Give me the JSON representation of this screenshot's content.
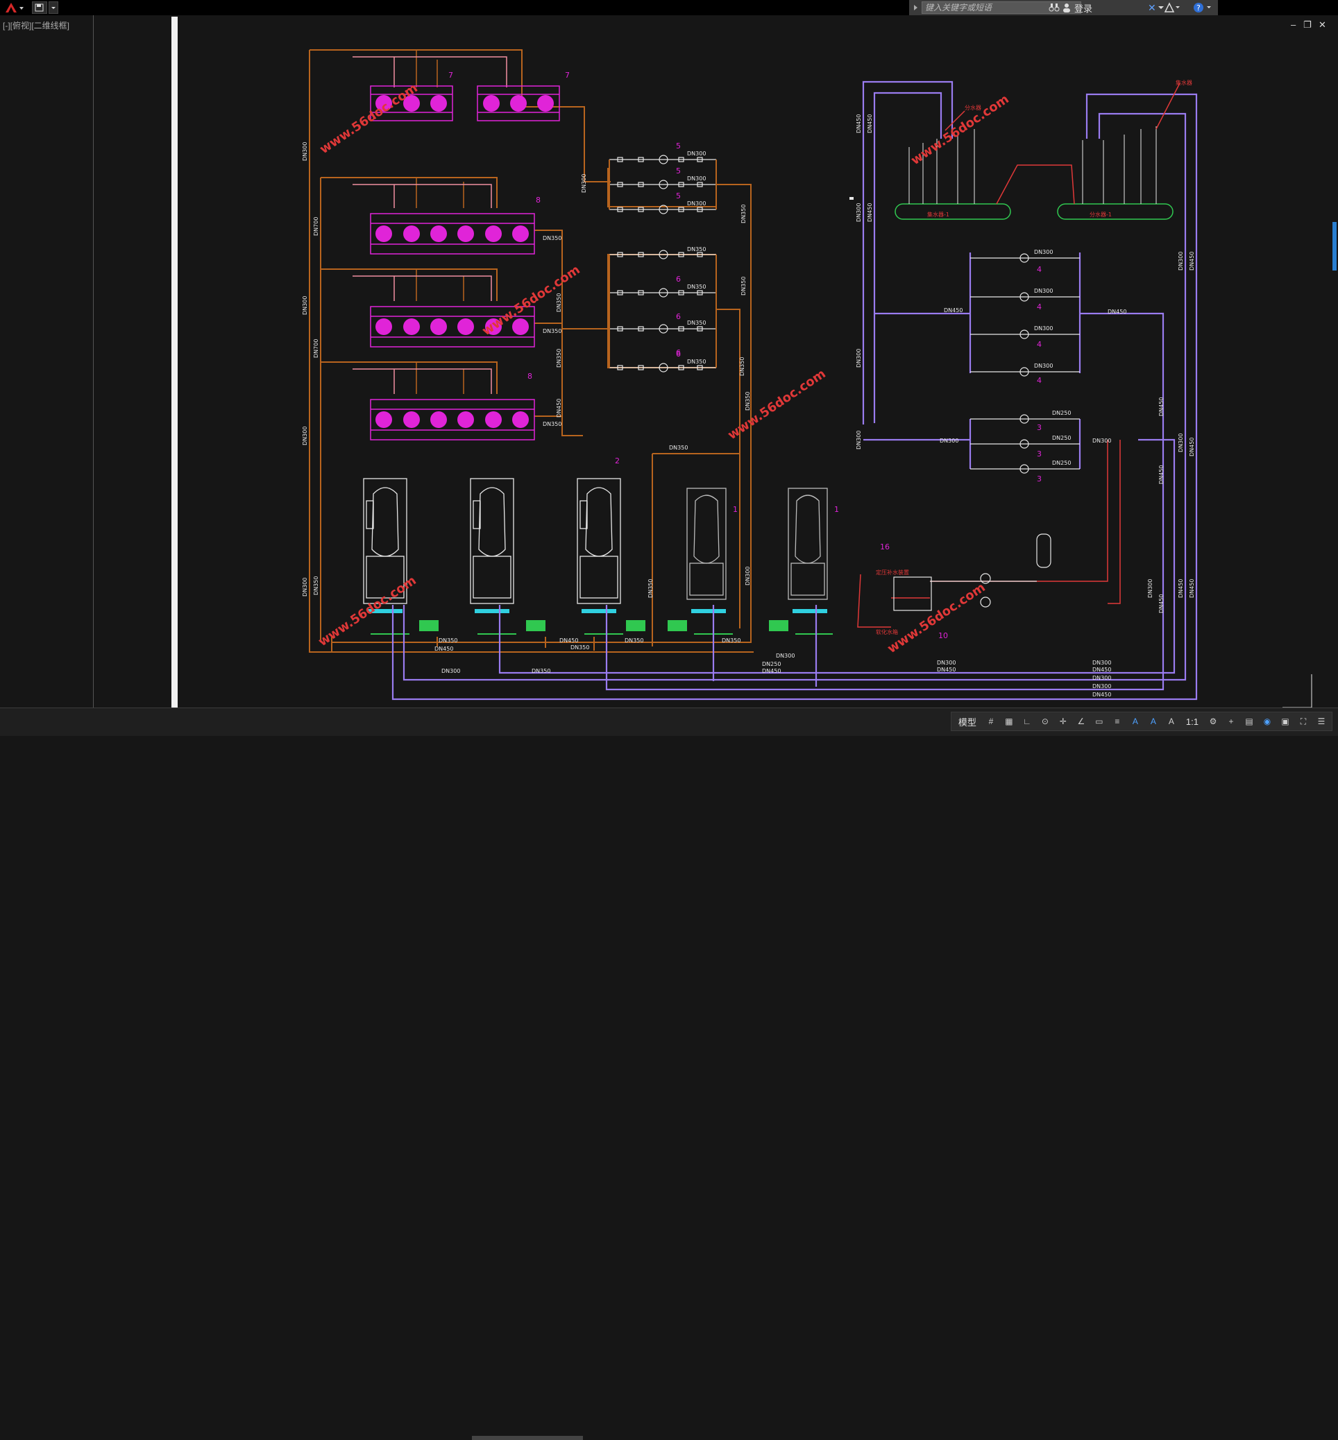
{
  "app": {
    "search_placeholder": "键入关键字或短语",
    "login_label": "登录",
    "view_label": "[-][俯视][二维线框]",
    "status": {
      "model_tab": "模型",
      "scale": "1:1"
    }
  },
  "drawing": {
    "watermark": "www.56doc.com",
    "labels_orange": [
      "DN300",
      "DN300",
      "DN300",
      "DN300",
      "DN350",
      "DN350",
      "DN350",
      "DN350",
      "DN300",
      "DN350",
      "DN450",
      "DN450",
      "DN350",
      "DN350",
      "DN450",
      "DN450",
      "DN350",
      "DN350",
      "DN350",
      "DN350",
      "DN300",
      "DN250",
      "DN450"
    ],
    "labels_purple": [
      "DN300",
      "DN300",
      "DN300",
      "DN450",
      "DN450",
      "DN450",
      "DN250",
      "DN250",
      "DN250",
      "DN300",
      "DN300",
      "DN300",
      "DN300",
      "DN450",
      "DN450",
      "DN450",
      "DN300",
      "DN300",
      "DN450",
      "DN450"
    ],
    "numbers": [
      "7",
      "7",
      "8",
      "8",
      "6",
      "6",
      "6",
      "6",
      "5",
      "5",
      "5",
      "4",
      "4",
      "4",
      "4",
      "3",
      "3",
      "3",
      "2",
      "1",
      "1",
      "16",
      "10"
    ],
    "red_notes": [
      "集水器",
      "分水器",
      "集水器-1",
      "分水器-1",
      "定压补水装置",
      "软化水箱"
    ]
  },
  "colors": {
    "orange": "#b8641e",
    "purple": "#9a7cf0",
    "magenta": "#e024d8",
    "red": "#e03838",
    "green": "#30c850",
    "pink": "#f08fa0",
    "white": "#e8e8e8",
    "cyan": "#30d0e0"
  }
}
